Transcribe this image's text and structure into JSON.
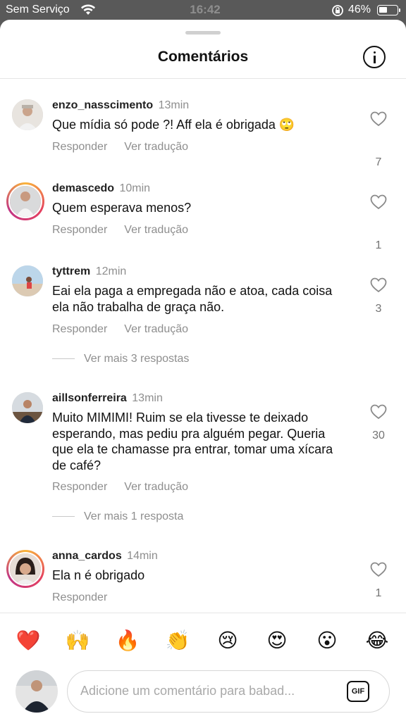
{
  "status_bar": {
    "carrier": "Sem Serviço",
    "time": "16:42",
    "battery_percent": "46%"
  },
  "header": {
    "title": "Comentários",
    "icon": "info-icon"
  },
  "comments": [
    {
      "username": "enzo_nasscimento",
      "time": "13min",
      "text": "Que mídia só pode ?! Aff ela é obrigada 🙄",
      "reply_label": "Responder",
      "translate_label": "Ver tradução",
      "likes": "7"
    },
    {
      "username": "demascedo",
      "time": "10min",
      "text": "Quem esperava menos?",
      "reply_label": "Responder",
      "translate_label": "Ver tradução",
      "likes": "1"
    },
    {
      "username": "tyttrem",
      "time": "12min",
      "text": "Eai ela paga a empregada não e atoa, cada coisa ela não trabalha de graça não.",
      "reply_label": "Responder",
      "translate_label": "Ver tradução",
      "likes": "3",
      "more_replies": "Ver mais 3 respostas"
    },
    {
      "username": "aillsonferreira",
      "time": "13min",
      "text": "Muito MIMIMI!  Ruim se ela tivesse te deixado esperando, mas pediu pra alguém pegar. Queria que ela te chamasse pra entrar, tomar uma xícara de café?",
      "reply_label": "Responder",
      "translate_label": "Ver tradução",
      "likes": "30",
      "more_replies": "Ver mais 1 resposta"
    },
    {
      "username": "anna_cardos",
      "time": "14min",
      "text": "Ela n é obrigado",
      "reply_label": "Responder",
      "likes": "1"
    }
  ],
  "emoji_bar": [
    "❤️",
    "🙌",
    "🔥",
    "👏",
    "😢",
    "😍",
    "😮",
    "😂"
  ],
  "composer": {
    "placeholder": "Adicione um comentário para babad...",
    "gif_label": "GIF"
  },
  "colors": {
    "accent_ring": "#e4405f",
    "muted_text": "#8e8e8e",
    "status_bar_bg": "#595959"
  }
}
